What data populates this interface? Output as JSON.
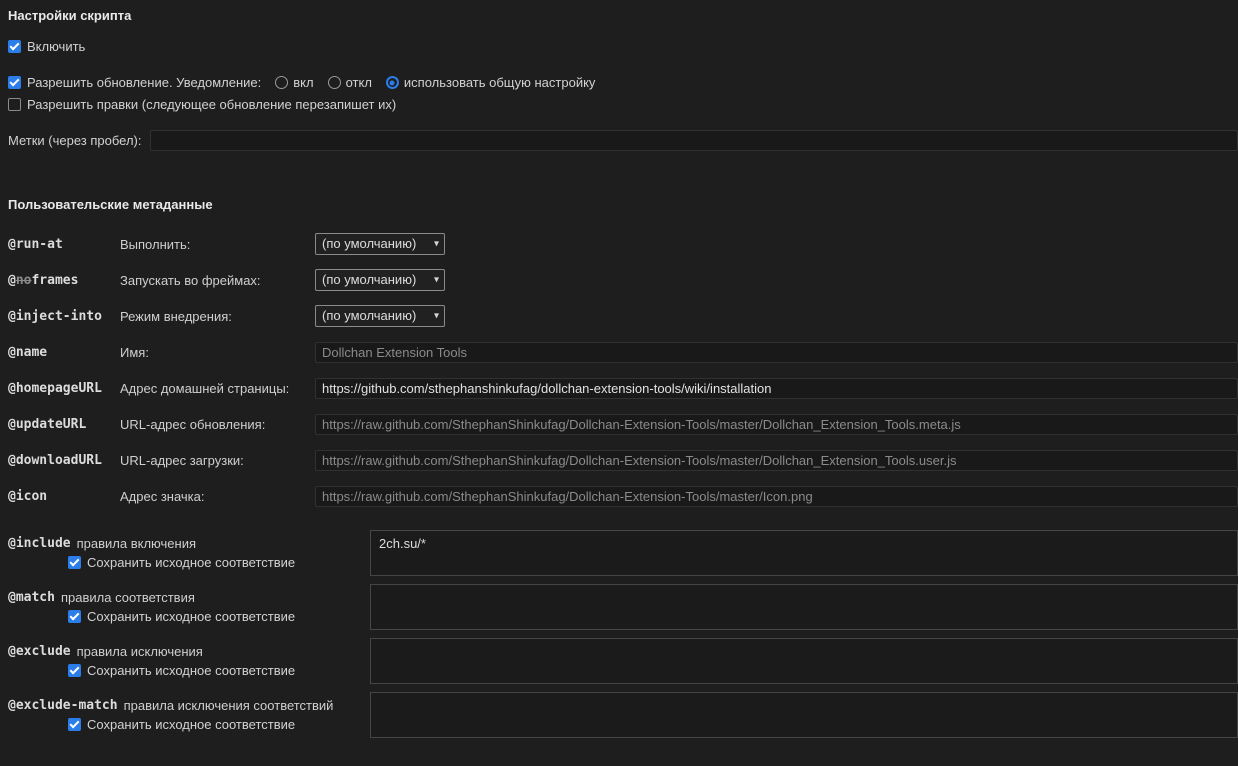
{
  "colors": {
    "accent": "#2b7de9",
    "background": "#1e1e1e"
  },
  "sections": {
    "script_settings": "Настройки скрипта",
    "custom_metadata": "Пользовательские метаданные"
  },
  "general": {
    "enable_label": "Включить",
    "allow_update_label": "Разрешить обновление. Уведомление:",
    "notify_on": "вкл",
    "notify_off": "откл",
    "notify_use_global": "использовать общую настройку",
    "allow_edits_label": "Разрешить правки (следующее обновление перезапишет их)",
    "tags_label": "Метки (через пробел):",
    "tags_value": ""
  },
  "meta": {
    "run_at": {
      "key": "@run-at",
      "label": "Выполнить:",
      "value": "(по умолчанию)"
    },
    "noframes": {
      "key_at": "@",
      "key_struck": "no",
      "key_rest": "frames",
      "label": "Запускать во фреймах:",
      "value": "(по умолчанию)"
    },
    "inject_into": {
      "key": "@inject-into",
      "label": "Режим внедрения:",
      "value": "(по умолчанию)"
    },
    "name": {
      "key": "@name",
      "label": "Имя:",
      "placeholder": "Dollchan Extension Tools"
    },
    "homepage_url": {
      "key": "@homepageURL",
      "label": "Адрес домашней страницы:",
      "value": "https://github.com/sthephanshinkufag/dollchan-extension-tools/wiki/installation"
    },
    "update_url": {
      "key": "@updateURL",
      "label": "URL-адрес обновления:",
      "placeholder": "https://raw.github.com/SthephanShinkufag/Dollchan-Extension-Tools/master/Dollchan_Extension_Tools.meta.js"
    },
    "download_url": {
      "key": "@downloadURL",
      "label": "URL-адрес загрузки:",
      "placeholder": "https://raw.github.com/SthephanShinkufag/Dollchan-Extension-Tools/master/Dollchan_Extension_Tools.user.js"
    },
    "icon": {
      "key": "@icon",
      "label": "Адрес значка:",
      "placeholder": "https://raw.github.com/SthephanShinkufag/Dollchan-Extension-Tools/master/Icon.png"
    }
  },
  "rules": {
    "keep_original_label": "Сохранить исходное соответствие",
    "include": {
      "key": "@include",
      "label": "правила включения",
      "value": "2ch.su/*"
    },
    "match": {
      "key": "@match",
      "label": "правила соответствия",
      "value": ""
    },
    "exclude": {
      "key": "@exclude",
      "label": "правила исключения",
      "value": ""
    },
    "exclude_match": {
      "key": "@exclude-match",
      "label": "правила исключения соответствий",
      "value": ""
    }
  }
}
